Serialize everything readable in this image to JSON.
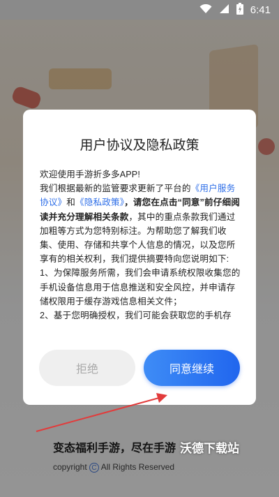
{
  "status_bar": {
    "time": "6:41",
    "icons": [
      "wifi-icon",
      "signal-icon",
      "battery-icon"
    ]
  },
  "dialog": {
    "title": "用户协议及隐私政策",
    "intro": "欢迎使用手游折多多APP!",
    "p1_before": "我们根据最新的监管要求更新了平台的",
    "link_user_agreement": "《用户服务协议》",
    "p1_and": "和",
    "link_privacy": "《隐私政策》",
    "p1_bold": "，请您在点击“同意”前仔细阅读并充分理解相关条款",
    "p1_after": "，其中的重点条款我们通过加粗等方式为您特别标注。为帮助您了解我们收集、使用、存储和共享个人信息的情况，以及您所享有的相关权利，我们提供摘要特向您说明如下:",
    "item1": "1、为保障服务所需，我们会申请系统权限收集您的手机设备信息用于信息推送和安全风控，并申请存储权限用于缓存游戏信息相关文件；",
    "item2": "2、基于您明确授权，我们可能会获取您的手机存",
    "refuse_button": "拒绝",
    "agree_button": "同意继续"
  },
  "background": {
    "slogan": "变态福利手游，尽在手游",
    "copyright_prefix": "copyright",
    "copyright_suffix": "All Rights Reserved"
  },
  "watermark": "沃德下载站",
  "colors": {
    "accent": "#2f6fe8",
    "agree_button": "#2166ee",
    "refuse_button_bg": "#efefef",
    "arrow": "#e23b3b"
  }
}
